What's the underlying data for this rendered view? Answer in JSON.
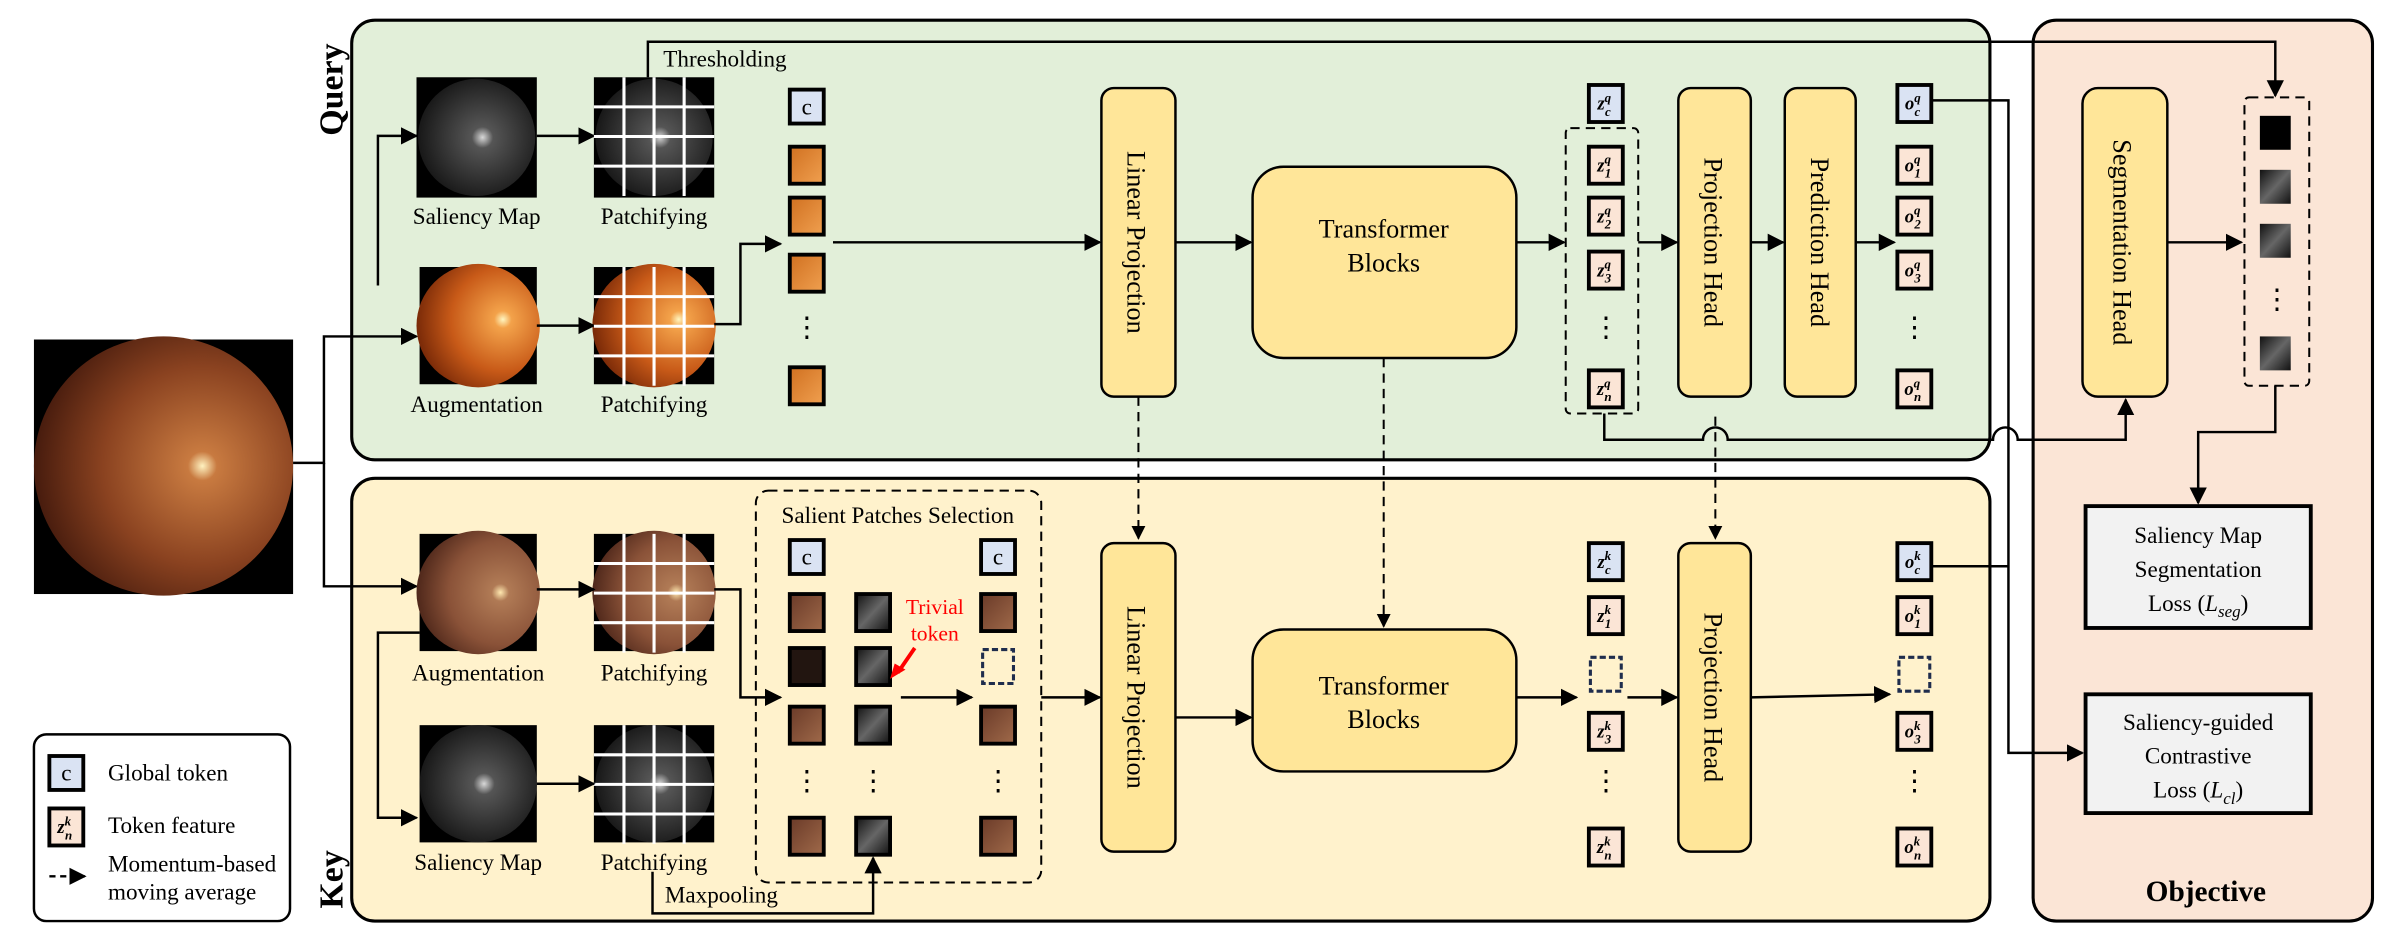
{
  "colors": {
    "query_panel": "#e2efd9",
    "key_panel": "#fff2cc",
    "objective_panel": "#fbe5d6",
    "block": "#ffe699",
    "global_token": "#dae3f3",
    "token_feature": "#fbe5d6",
    "loss_box": "#f2f2f2",
    "trivial": "#ff0000"
  },
  "query": {
    "title": "Query",
    "saliency_label": "Saliency Map",
    "patchify_label_top": "Patchifying",
    "augmentation_label": "Augmentation",
    "patchify_label_bottom": "Patchifying",
    "thresholding": "Thresholding",
    "global_token": "c",
    "linear_projection": "Linear Projection",
    "transformer_line1": "Transformer",
    "transformer_line2": "Blocks",
    "projection_head": "Projection Head",
    "prediction_head": "Prediction Head",
    "z_tokens": [
      {
        "base": "z",
        "sup": "q",
        "sub": "c"
      },
      {
        "base": "z",
        "sup": "q",
        "sub": "1"
      },
      {
        "base": "z",
        "sup": "q",
        "sub": "2"
      },
      {
        "base": "z",
        "sup": "q",
        "sub": "3"
      },
      {
        "base": "z",
        "sup": "q",
        "sub": "n"
      }
    ],
    "o_tokens": [
      {
        "base": "o",
        "sup": "q",
        "sub": "c"
      },
      {
        "base": "o",
        "sup": "q",
        "sub": "1"
      },
      {
        "base": "o",
        "sup": "q",
        "sub": "2"
      },
      {
        "base": "o",
        "sup": "q",
        "sub": "3"
      },
      {
        "base": "o",
        "sup": "q",
        "sub": "n"
      }
    ],
    "ellipsis": "⋮"
  },
  "key": {
    "title": "Key",
    "augmentation_label": "Augmentation",
    "patchify_label_top": "Patchifying",
    "saliency_label": "Saliency Map",
    "patchify_label_bottom": "Patchifying",
    "selection_title": "Salient Patches Selection",
    "global_token": "c",
    "trivial_line1": "Trivial",
    "trivial_line2": "token",
    "maxpooling": "Maxpooling",
    "linear_projection": "Linear Projection",
    "transformer_line1": "Transformer",
    "transformer_line2": "Blocks",
    "projection_head": "Projection Head",
    "z_tokens": [
      {
        "base": "z",
        "sup": "k",
        "sub": "c"
      },
      {
        "base": "z",
        "sup": "k",
        "sub": "1"
      },
      null,
      {
        "base": "z",
        "sup": "k",
        "sub": "3"
      },
      {
        "base": "z",
        "sup": "k",
        "sub": "n"
      }
    ],
    "o_tokens": [
      {
        "base": "o",
        "sup": "k",
        "sub": "c"
      },
      {
        "base": "o",
        "sup": "k",
        "sub": "1"
      },
      null,
      {
        "base": "o",
        "sup": "k",
        "sub": "3"
      },
      {
        "base": "o",
        "sup": "k",
        "sub": "n"
      }
    ],
    "ellipsis": "⋮"
  },
  "objective": {
    "title": "Objective",
    "segmentation_head": "Segmentation Head",
    "seg_loss": [
      "Saliency Map",
      "Segmentation",
      "Loss ("
    ],
    "seg_loss_sym": {
      "base": "L",
      "sub": "seg"
    },
    "cl_loss": [
      "Saliency-guided",
      "Contrastive",
      "Loss ("
    ],
    "cl_loss_sym": {
      "base": "L",
      "sub": "cl"
    }
  },
  "legend": {
    "global_icon": "c",
    "global_label": "Global token",
    "feature_icon": {
      "base": "z",
      "sup": "k",
      "sub": "n"
    },
    "feature_label": "Token feature",
    "momentum_line1": "Momentum-based",
    "momentum_line2": "moving average"
  }
}
